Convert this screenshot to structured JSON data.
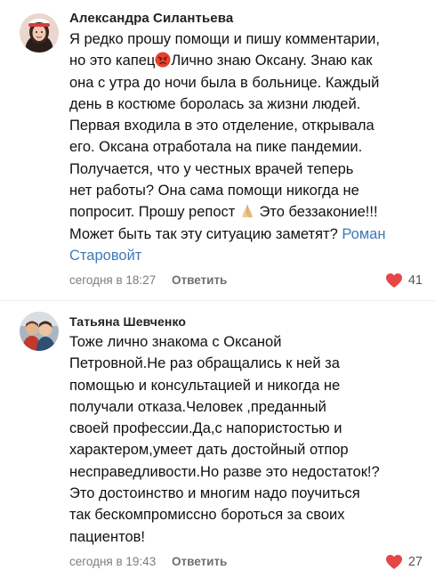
{
  "comments": [
    {
      "author": "Александра Силантьева",
      "lines": [
        "Я редко прошу помощи и пишу комментарии,",
        "но это капец",
        "Лично знаю Оксану. Знаю как",
        "она с утра до ночи была в больнице. Каждый",
        "день в костюме боролась за жизни людей.",
        "Первая входила в это отделение, открывала",
        "его. Оксана отработала на пике пандемии.",
        "Получается, что у честных врачей теперь",
        "нет работы? Она сама помощи никогда не",
        "попросит. Прошу репост",
        "Это беззаконие!!!",
        "Может быть так эту ситуацию заметят?",
        "Роман",
        "Старовойт"
      ],
      "emojis": [
        "angry-face-emoji",
        "praying-hands-emoji"
      ],
      "time": "сегодня в 18:27",
      "reply_label": "Ответить",
      "likes": "41",
      "link_color": "#3f78b6"
    },
    {
      "author": "Татьяна Шевченко",
      "lines": [
        "Тоже лично знакома с Оксаной",
        "Петровной.Не раз обращались к ней за",
        "помощью и консультацией и никогда не",
        "получали отказа.Человек ,преданный",
        "своей профессии.Да,с напористостью и",
        "характером,умеет дать достойный отпор",
        "несправедливости.Но разве это недостаток!?",
        "Это достоинство и многим надо поучиться",
        "так бескомпромиссно бороться за своих",
        "пациентов!"
      ],
      "time": "сегодня в 19:43",
      "reply_label": "Ответить",
      "likes": "27"
    }
  ],
  "colors": {
    "heart": "#e64646",
    "link": "#3f78b6",
    "meta": "#7d7d7d"
  },
  "icons": [
    "heart-icon",
    "avatar"
  ]
}
